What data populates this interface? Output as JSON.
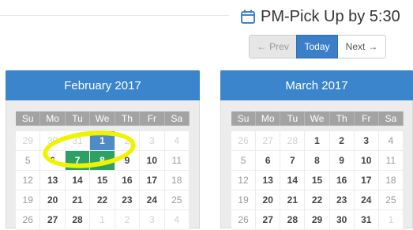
{
  "event": {
    "icon": "calendar-icon",
    "title": "PM-Pick Up by 5:30"
  },
  "nav": {
    "prev_label": "Prev",
    "prev_icon": "arrow-left-icon",
    "today_label": "Today",
    "next_label": "Next",
    "next_icon": "arrow-right-icon"
  },
  "calendars": [
    {
      "title": "February 2017",
      "weekdays": [
        "Su",
        "Mo",
        "Tu",
        "We",
        "Th",
        "Fr",
        "Sa"
      ],
      "weeks": [
        [
          {
            "d": "29",
            "s": "muted"
          },
          {
            "d": "30",
            "s": "muted"
          },
          {
            "d": "31",
            "s": "muted"
          },
          {
            "d": "1",
            "s": "blue"
          },
          {
            "d": "2",
            "s": "muted"
          },
          {
            "d": "3",
            "s": "muted"
          },
          {
            "d": "4",
            "s": "muted"
          }
        ],
        [
          {
            "d": "5",
            "s": "past"
          },
          {
            "d": "6",
            "s": ""
          },
          {
            "d": "7",
            "s": "green"
          },
          {
            "d": "8",
            "s": "green"
          },
          {
            "d": "9",
            "s": ""
          },
          {
            "d": "10",
            "s": ""
          },
          {
            "d": "11",
            "s": "past"
          }
        ],
        [
          {
            "d": "12",
            "s": "past"
          },
          {
            "d": "13",
            "s": ""
          },
          {
            "d": "14",
            "s": ""
          },
          {
            "d": "15",
            "s": ""
          },
          {
            "d": "16",
            "s": ""
          },
          {
            "d": "17",
            "s": ""
          },
          {
            "d": "18",
            "s": "past"
          }
        ],
        [
          {
            "d": "19",
            "s": "past"
          },
          {
            "d": "20",
            "s": ""
          },
          {
            "d": "21",
            "s": ""
          },
          {
            "d": "22",
            "s": ""
          },
          {
            "d": "23",
            "s": ""
          },
          {
            "d": "24",
            "s": ""
          },
          {
            "d": "25",
            "s": "past"
          }
        ],
        [
          {
            "d": "26",
            "s": "past"
          },
          {
            "d": "27",
            "s": ""
          },
          {
            "d": "28",
            "s": ""
          },
          {
            "d": "1",
            "s": "muted"
          },
          {
            "d": "2",
            "s": "muted"
          },
          {
            "d": "3",
            "s": "muted"
          },
          {
            "d": "4",
            "s": "muted"
          }
        ]
      ]
    },
    {
      "title": "March 2017",
      "weekdays": [
        "Su",
        "Mo",
        "Tu",
        "We",
        "Th",
        "Fr",
        "Sa"
      ],
      "weeks": [
        [
          {
            "d": "26",
            "s": "muted"
          },
          {
            "d": "27",
            "s": "muted"
          },
          {
            "d": "28",
            "s": "muted"
          },
          {
            "d": "1",
            "s": ""
          },
          {
            "d": "2",
            "s": ""
          },
          {
            "d": "3",
            "s": ""
          },
          {
            "d": "4",
            "s": "past"
          }
        ],
        [
          {
            "d": "5",
            "s": "past"
          },
          {
            "d": "6",
            "s": ""
          },
          {
            "d": "7",
            "s": ""
          },
          {
            "d": "8",
            "s": ""
          },
          {
            "d": "9",
            "s": ""
          },
          {
            "d": "10",
            "s": ""
          },
          {
            "d": "11",
            "s": "past"
          }
        ],
        [
          {
            "d": "12",
            "s": "past"
          },
          {
            "d": "13",
            "s": ""
          },
          {
            "d": "14",
            "s": ""
          },
          {
            "d": "15",
            "s": ""
          },
          {
            "d": "16",
            "s": ""
          },
          {
            "d": "17",
            "s": ""
          },
          {
            "d": "18",
            "s": "past"
          }
        ],
        [
          {
            "d": "19",
            "s": "past"
          },
          {
            "d": "20",
            "s": ""
          },
          {
            "d": "21",
            "s": ""
          },
          {
            "d": "22",
            "s": ""
          },
          {
            "d": "23",
            "s": ""
          },
          {
            "d": "24",
            "s": ""
          },
          {
            "d": "25",
            "s": "past"
          }
        ],
        [
          {
            "d": "26",
            "s": "past"
          },
          {
            "d": "27",
            "s": ""
          },
          {
            "d": "28",
            "s": ""
          },
          {
            "d": "29",
            "s": ""
          },
          {
            "d": "30",
            "s": ""
          },
          {
            "d": "31",
            "s": ""
          },
          {
            "d": "1",
            "s": "muted"
          }
        ]
      ]
    }
  ],
  "colors": {
    "header_blue": "#3a85cb",
    "today_button": "#3a7fc8",
    "selected_day_blue": "#4f8bc4",
    "selected_day_green": "#2da163",
    "highlight_marker": "#f0f300"
  }
}
